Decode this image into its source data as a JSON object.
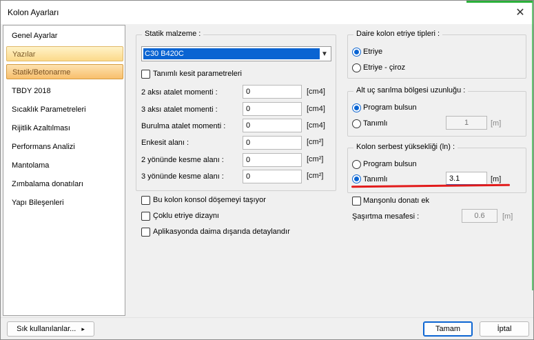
{
  "window": {
    "title": "Kolon Ayarları"
  },
  "nav": {
    "items": [
      {
        "label": "Genel Ayarlar"
      },
      {
        "label": "Yazılar"
      },
      {
        "label": "Statik/Betonarme"
      },
      {
        "label": "TBDY 2018"
      },
      {
        "label": "Sıcaklık Parametreleri"
      },
      {
        "label": "Rijitlik Azaltılması"
      },
      {
        "label": "Performans Analizi"
      },
      {
        "label": "Mantolama"
      },
      {
        "label": "Zımbalama donatıları"
      },
      {
        "label": "Yapı Bileşenleri"
      }
    ]
  },
  "material": {
    "group_title": "Statik malzeme :",
    "selected": "C30 B420C",
    "custom_section_label": "Tanımlı kesit parametreleri",
    "rows": [
      {
        "label": "2 aksı atalet momenti :",
        "value": "0",
        "unit": "[cm4]"
      },
      {
        "label": "3 aksı atalet momenti :",
        "value": "0",
        "unit": "[cm4]"
      },
      {
        "label": "Burulma atalet momenti :",
        "value": "0",
        "unit": "[cm4]"
      },
      {
        "label": "Enkesit alanı :",
        "value": "0",
        "unit": "[cm²]"
      },
      {
        "label": "2 yönünde kesme alanı :",
        "value": "0",
        "unit": "[cm²]"
      },
      {
        "label": "3 yönünde kesme alanı :",
        "value": "0",
        "unit": "[cm²]"
      }
    ]
  },
  "options": {
    "console": "Bu kolon konsol döşemeyi taşıyor",
    "multi_stirrup": "Çoklu etriye dizaynı",
    "application": "Aplikasyonda daima dışarıda detaylandır"
  },
  "stirrup_types": {
    "title": "Daire kolon etriye tipleri :",
    "opt1": "Etriye",
    "opt2": "Etriye - çiroz"
  },
  "confinement": {
    "title": "Alt uç sarılma bölgesi uzunluğu :",
    "opt1": "Program bulsun",
    "opt2": "Tanımlı",
    "value": "1",
    "unit": "[m]"
  },
  "free_height": {
    "title": "Kolon serbest yüksekliği (ln) :",
    "opt1": "Program bulsun",
    "opt2": "Tanımlı",
    "value": "3.1",
    "unit": "[m]"
  },
  "sleeve": {
    "label": "Manşonlu donatı ek",
    "offset_label": "Şaşırtma mesafesi :",
    "offset_value": "0.6",
    "offset_unit": "[m]"
  },
  "footer": {
    "favorites": "Sık kullanılanlar...",
    "favorites_arrow": "▸",
    "ok": "Tamam",
    "cancel": "İptal"
  },
  "colors": {
    "accent": "#0a64d2",
    "highlight_underline": "#e21b1b",
    "nav_active": "#f8bf6c"
  }
}
